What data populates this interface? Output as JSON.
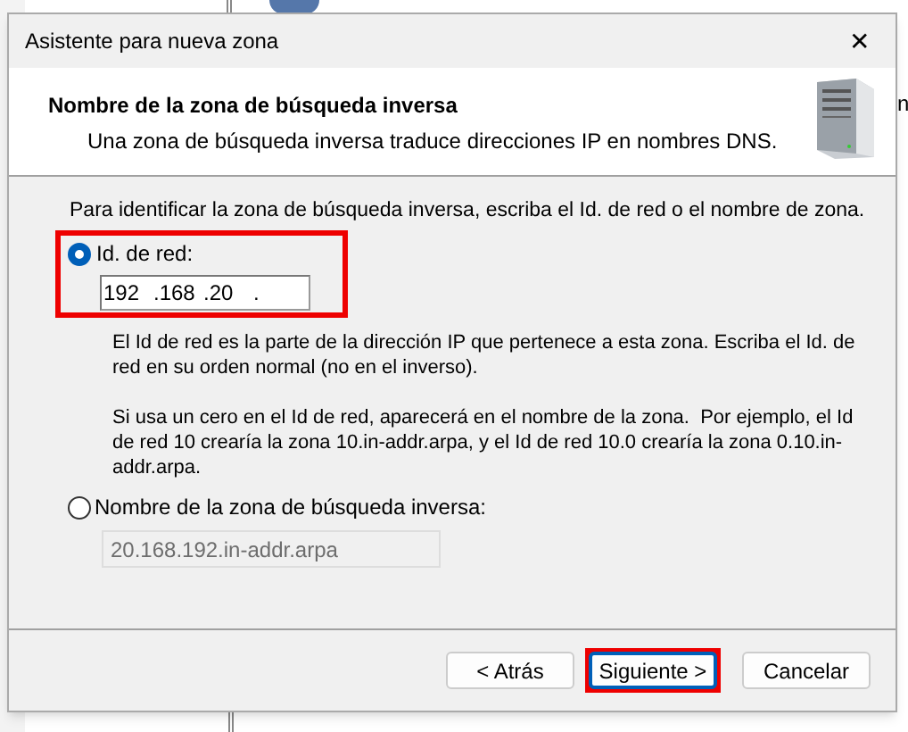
{
  "background": {
    "fragments": [
      "n"
    ]
  },
  "window": {
    "title": "Asistente para nueva zona",
    "close": "✕"
  },
  "header": {
    "title": "Nombre de la zona de búsqueda inversa",
    "subtitle": "Una zona de búsqueda inversa traduce direcciones IP en nombres DNS."
  },
  "intro": "Para identificar la zona de búsqueda inversa, escriba el Id. de red o el nombre de zona.",
  "options": [
    {
      "kind": "network_id",
      "label": "Id. de red:",
      "selected": true,
      "highlighted": true,
      "octets": [
        "192",
        ".168",
        ".20",
        "."
      ],
      "notes": [
        "El Id de red es la parte de la dirección IP que pertenece a esta zona. Escriba el Id. de red en su orden normal (no en el inverso).",
        "Si usa un cero en el Id de red, aparecerá en el nombre de la zona.  Por ejemplo, el Id de red 10 crearía la zona 10.in-addr.arpa, y el Id de red 10.0 crearía la zona 0.10.in-addr.arpa."
      ]
    },
    {
      "kind": "zone_name",
      "label": "Nombre de la zona de búsqueda inversa:",
      "selected": false,
      "value": "20.168.192.in-addr.arpa",
      "disabled": true
    }
  ],
  "buttons": [
    {
      "label": "< Atrás",
      "highlighted": false,
      "default": false
    },
    {
      "label": "Siguiente >",
      "highlighted": true,
      "default": true
    },
    {
      "label": "Cancelar",
      "highlighted": false,
      "default": false
    }
  ]
}
